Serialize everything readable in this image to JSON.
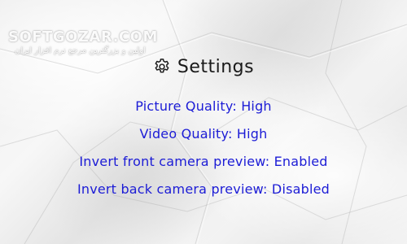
{
  "watermark": {
    "line1": "SOFTGOZAR.COM",
    "line2": "اولین و بزرگترین مرجع نرم افزار ایران"
  },
  "header": {
    "icon": "gear-icon",
    "title": "Settings"
  },
  "settings": [
    {
      "label": "Picture Quality: High"
    },
    {
      "label": "Video Quality: High"
    },
    {
      "label": "Invert front camera preview: Enabled"
    },
    {
      "label": "Invert back camera preview: Disabled"
    }
  ],
  "colors": {
    "setting_text": "#1c1cd6",
    "title_text": "#1a1a1a"
  }
}
